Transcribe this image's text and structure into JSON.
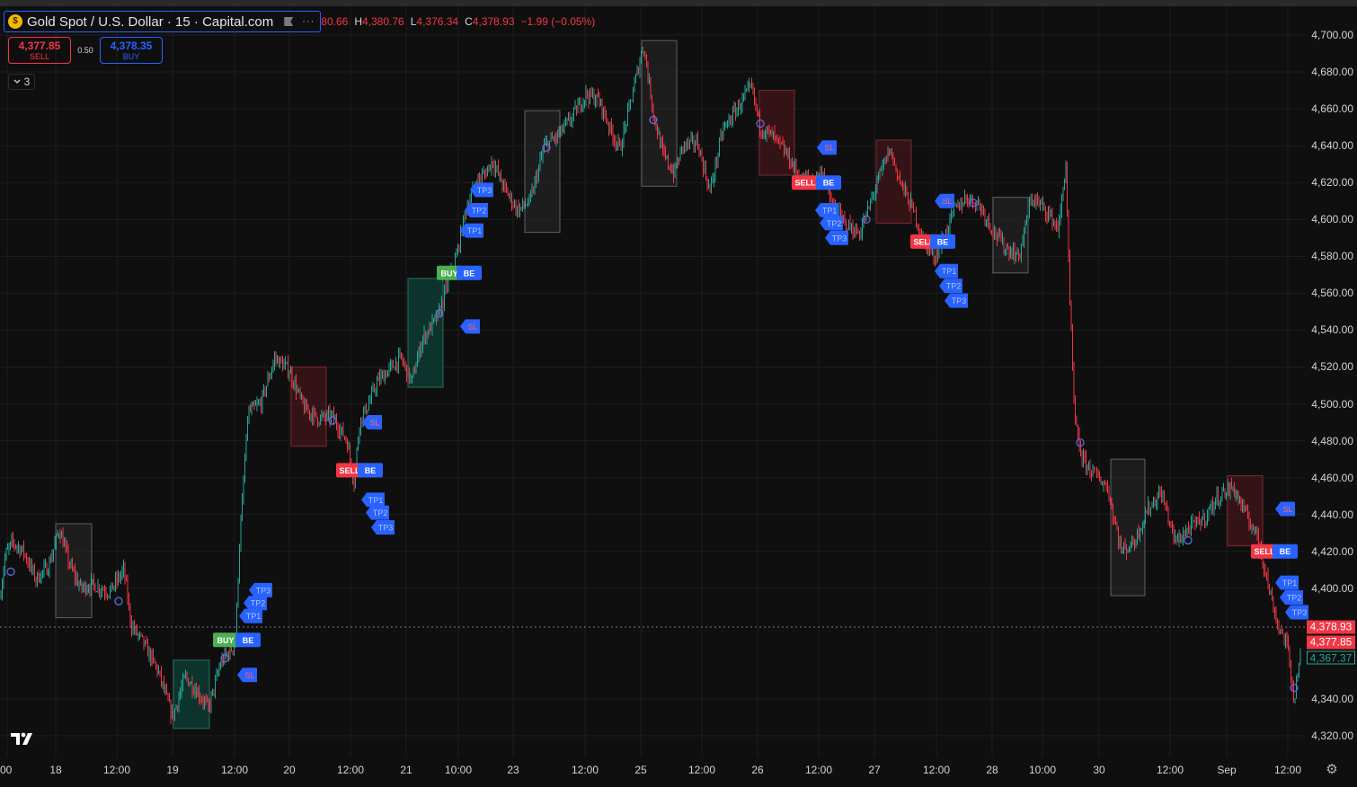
{
  "header": {
    "symbol_title": "Gold Spot / U.S. Dollar · 15 · Capital.com",
    "more_icon": "···",
    "ohlc_prefix": "80.66",
    "high_label": "H",
    "high": "4,380.76",
    "low_label": "L",
    "low": "4,376.34",
    "close_label": "C",
    "close": "4,378.93",
    "change": "−1.99 (−0.05%)"
  },
  "trade": {
    "sell_price": "4,377.85",
    "sell_label": "SELL",
    "spread": "0.50",
    "buy_price": "4,378.35",
    "buy_label": "BUY"
  },
  "indicators_count": "3",
  "colors": {
    "background": "#0f0f0f",
    "up": "#26a69a",
    "down": "#f23645",
    "accent": "#2962ff",
    "buy_signal": "#4caf50",
    "sell_signal": "#f23645"
  },
  "icons": [
    "gold-coin-icon",
    "flag-icon",
    "more-dots-icon",
    "chevron-down-icon",
    "tradingview-logo-icon",
    "settings-gear-icon"
  ],
  "price_tags": {
    "last_price": "4,378.93",
    "bid": "4,377.85",
    "indicator_value": "4,367.37"
  },
  "chart_data": {
    "type": "candlestick",
    "title": "Gold Spot / U.S. Dollar · 15 · Capital.com",
    "y_axis_side": "right",
    "ylim": [
      4315,
      4705
    ],
    "y_ticks": [
      "4,700.00",
      "4,680.00",
      "4,660.00",
      "4,640.00",
      "4,620.00",
      "4,600.00",
      "4,580.00",
      "4,560.00",
      "4,540.00",
      "4,520.00",
      "4,500.00",
      "4,480.00",
      "4,460.00",
      "4,440.00",
      "4,420.00",
      "4,400.00",
      "4,340.00",
      "4,320.00"
    ],
    "y_tick_values": [
      4700,
      4680,
      4660,
      4640,
      4620,
      4600,
      4580,
      4560,
      4540,
      4520,
      4500,
      4480,
      4460,
      4440,
      4420,
      4400,
      4340,
      4320
    ],
    "x_ticks": [
      "00",
      "18",
      "12:00",
      "19",
      "12:00",
      "20",
      "12:00",
      "21",
      "10:00",
      "23",
      "12:00",
      "25",
      "12:00",
      "26",
      "12:00",
      "27",
      "12:00",
      "28",
      "10:00",
      "30",
      "12:00",
      "Sep",
      "12:00"
    ],
    "grid": true,
    "price_path": [
      [
        0,
        4395
      ],
      [
        6,
        4418
      ],
      [
        14,
        4425
      ],
      [
        26,
        4420
      ],
      [
        40,
        4405
      ],
      [
        54,
        4412
      ],
      [
        66,
        4432
      ],
      [
        78,
        4412
      ],
      [
        90,
        4400
      ],
      [
        102,
        4402
      ],
      [
        122,
        4398
      ],
      [
        138,
        4410
      ],
      [
        146,
        4380
      ],
      [
        160,
        4370
      ],
      [
        176,
        4355
      ],
      [
        192,
        4330
      ],
      [
        206,
        4352
      ],
      [
        218,
        4345
      ],
      [
        232,
        4335
      ],
      [
        246,
        4360
      ],
      [
        262,
        4370
      ],
      [
        266,
        4420
      ],
      [
        276,
        4495
      ],
      [
        290,
        4500
      ],
      [
        306,
        4525
      ],
      [
        322,
        4518
      ],
      [
        338,
        4498
      ],
      [
        354,
        4492
      ],
      [
        370,
        4493
      ],
      [
        386,
        4480
      ],
      [
        394,
        4458
      ],
      [
        400,
        4490
      ],
      [
        410,
        4500
      ],
      [
        420,
        4512
      ],
      [
        432,
        4518
      ],
      [
        446,
        4525
      ],
      [
        458,
        4512
      ],
      [
        470,
        4535
      ],
      [
        488,
        4548
      ],
      [
        498,
        4565
      ],
      [
        508,
        4580
      ],
      [
        518,
        4605
      ],
      [
        530,
        4620
      ],
      [
        540,
        4625
      ],
      [
        548,
        4632
      ],
      [
        560,
        4618
      ],
      [
        576,
        4605
      ],
      [
        590,
        4610
      ],
      [
        606,
        4640
      ],
      [
        620,
        4645
      ],
      [
        636,
        4655
      ],
      [
        652,
        4668
      ],
      [
        666,
        4665
      ],
      [
        680,
        4648
      ],
      [
        690,
        4638
      ],
      [
        700,
        4660
      ],
      [
        716,
        4695
      ],
      [
        728,
        4655
      ],
      [
        738,
        4635
      ],
      [
        750,
        4625
      ],
      [
        760,
        4640
      ],
      [
        776,
        4642
      ],
      [
        790,
        4615
      ],
      [
        804,
        4648
      ],
      [
        820,
        4660
      ],
      [
        836,
        4672
      ],
      [
        846,
        4650
      ],
      [
        860,
        4645
      ],
      [
        876,
        4635
      ],
      [
        890,
        4622
      ],
      [
        904,
        4622
      ],
      [
        916,
        4625
      ],
      [
        926,
        4608
      ],
      [
        940,
        4598
      ],
      [
        956,
        4592
      ],
      [
        966,
        4605
      ],
      [
        976,
        4620
      ],
      [
        990,
        4638
      ],
      [
        1002,
        4620
      ],
      [
        1016,
        4605
      ],
      [
        1028,
        4588
      ],
      [
        1040,
        4580
      ],
      [
        1050,
        4590
      ],
      [
        1062,
        4605
      ],
      [
        1076,
        4612
      ],
      [
        1090,
        4608
      ],
      [
        1104,
        4595
      ],
      [
        1118,
        4585
      ],
      [
        1134,
        4580
      ],
      [
        1148,
        4612
      ],
      [
        1164,
        4605
      ],
      [
        1178,
        4595
      ],
      [
        1186,
        4630
      ],
      [
        1190,
        4560
      ],
      [
        1196,
        4490
      ],
      [
        1204,
        4470
      ],
      [
        1218,
        4462
      ],
      [
        1232,
        4455
      ],
      [
        1248,
        4420
      ],
      [
        1262,
        4425
      ],
      [
        1276,
        4442
      ],
      [
        1292,
        4452
      ],
      [
        1308,
        4425
      ],
      [
        1322,
        4432
      ],
      [
        1340,
        4438
      ],
      [
        1356,
        4450
      ],
      [
        1372,
        4455
      ],
      [
        1386,
        4440
      ],
      [
        1400,
        4428
      ],
      [
        1412,
        4400
      ],
      [
        1422,
        4380
      ],
      [
        1432,
        4370
      ],
      [
        1440,
        4340
      ],
      [
        1448,
        4368
      ]
    ],
    "zones": [
      {
        "x0": 62,
        "x1": 102,
        "top": 4435,
        "bottom": 4384,
        "kind": "neutral"
      },
      {
        "x0": 193,
        "x1": 233,
        "top": 4361,
        "bottom": 4324,
        "kind": "bullish"
      },
      {
        "x0": 324,
        "x1": 363,
        "top": 4520,
        "bottom": 4477,
        "kind": "bearish"
      },
      {
        "x0": 454,
        "x1": 493,
        "top": 4568,
        "bottom": 4509,
        "kind": "bullish"
      },
      {
        "x0": 584,
        "x1": 623,
        "top": 4659,
        "bottom": 4593,
        "kind": "neutral"
      },
      {
        "x0": 714,
        "x1": 753,
        "top": 4697,
        "bottom": 4618,
        "kind": "neutral"
      },
      {
        "x0": 845,
        "x1": 884,
        "top": 4670,
        "bottom": 4624,
        "kind": "bearish"
      },
      {
        "x0": 975,
        "x1": 1014,
        "top": 4643,
        "bottom": 4598,
        "kind": "bearish"
      },
      {
        "x0": 1105,
        "x1": 1144,
        "top": 4612,
        "bottom": 4571,
        "kind": "neutral"
      },
      {
        "x0": 1236,
        "x1": 1274,
        "top": 4470,
        "bottom": 4396,
        "kind": "neutral"
      },
      {
        "x0": 1366,
        "x1": 1405,
        "top": 4461,
        "bottom": 4423,
        "kind": "bearish"
      }
    ],
    "signals": [
      {
        "x": 237,
        "price": 4372,
        "kind": "buy",
        "label": "BUY"
      },
      {
        "x": 262,
        "price": 4372,
        "kind": "be",
        "label": "BE"
      },
      {
        "x": 264,
        "price": 4353,
        "kind": "sl",
        "label": "SL"
      },
      {
        "x": 266,
        "price": 4385,
        "kind": "tp",
        "label": "TP1"
      },
      {
        "x": 271,
        "price": 4392,
        "kind": "tp",
        "label": "TP2"
      },
      {
        "x": 277,
        "price": 4399,
        "kind": "tp",
        "label": "TP3"
      },
      {
        "x": 374,
        "price": 4464,
        "kind": "sell",
        "label": "SELL"
      },
      {
        "x": 398,
        "price": 4464,
        "kind": "be",
        "label": "BE"
      },
      {
        "x": 403,
        "price": 4490,
        "kind": "sl",
        "label": "SL"
      },
      {
        "x": 402,
        "price": 4448,
        "kind": "tp",
        "label": "TP1"
      },
      {
        "x": 407,
        "price": 4441,
        "kind": "tp",
        "label": "TP2"
      },
      {
        "x": 413,
        "price": 4433,
        "kind": "tp",
        "label": "TP3"
      },
      {
        "x": 486,
        "price": 4571,
        "kind": "buy",
        "label": "BUY"
      },
      {
        "x": 508,
        "price": 4571,
        "kind": "be",
        "label": "BE"
      },
      {
        "x": 512,
        "price": 4542,
        "kind": "sl",
        "label": "SL"
      },
      {
        "x": 512,
        "price": 4594,
        "kind": "tp",
        "label": "TP1"
      },
      {
        "x": 517,
        "price": 4605,
        "kind": "tp",
        "label": "TP2"
      },
      {
        "x": 523,
        "price": 4616,
        "kind": "tp",
        "label": "TP3"
      },
      {
        "x": 881,
        "price": 4620,
        "kind": "sell",
        "label": "SELL"
      },
      {
        "x": 908,
        "price": 4620,
        "kind": "be",
        "label": "BE"
      },
      {
        "x": 909,
        "price": 4639,
        "kind": "sl",
        "label": "SL"
      },
      {
        "x": 907,
        "price": 4605,
        "kind": "tp",
        "label": "TP1"
      },
      {
        "x": 912,
        "price": 4598,
        "kind": "tp",
        "label": "TP2"
      },
      {
        "x": 918,
        "price": 4590,
        "kind": "tp",
        "label": "TP3"
      },
      {
        "x": 1013,
        "price": 4588,
        "kind": "sell",
        "label": "SELL"
      },
      {
        "x": 1035,
        "price": 4588,
        "kind": "be",
        "label": "BE"
      },
      {
        "x": 1040,
        "price": 4610,
        "kind": "sl",
        "label": "SL"
      },
      {
        "x": 1040,
        "price": 4572,
        "kind": "tp",
        "label": "TP1"
      },
      {
        "x": 1045,
        "price": 4564,
        "kind": "tp",
        "label": "TP2"
      },
      {
        "x": 1051,
        "price": 4556,
        "kind": "tp",
        "label": "TP3"
      },
      {
        "x": 1392,
        "price": 4420,
        "kind": "sell",
        "label": "SELL"
      },
      {
        "x": 1416,
        "price": 4420,
        "kind": "be",
        "label": "BE"
      },
      {
        "x": 1419,
        "price": 4443,
        "kind": "sl",
        "label": "SL"
      },
      {
        "x": 1419,
        "price": 4403,
        "kind": "tp",
        "label": "TP1"
      },
      {
        "x": 1424,
        "price": 4395,
        "kind": "tp",
        "label": "TP2"
      },
      {
        "x": 1430,
        "price": 4387,
        "kind": "tp",
        "label": "TP3"
      }
    ],
    "pivot_markers": [
      {
        "x": 12,
        "price": 4409
      },
      {
        "x": 132,
        "price": 4393
      },
      {
        "x": 250,
        "price": 4362
      },
      {
        "x": 370,
        "price": 4491
      },
      {
        "x": 489,
        "price": 4549
      },
      {
        "x": 608,
        "price": 4639
      },
      {
        "x": 727,
        "price": 4654
      },
      {
        "x": 846,
        "price": 4652
      },
      {
        "x": 964,
        "price": 4600
      },
      {
        "x": 1083,
        "price": 4609
      },
      {
        "x": 1202,
        "price": 4479
      },
      {
        "x": 1322,
        "price": 4426
      },
      {
        "x": 1440,
        "price": 4346
      }
    ]
  }
}
